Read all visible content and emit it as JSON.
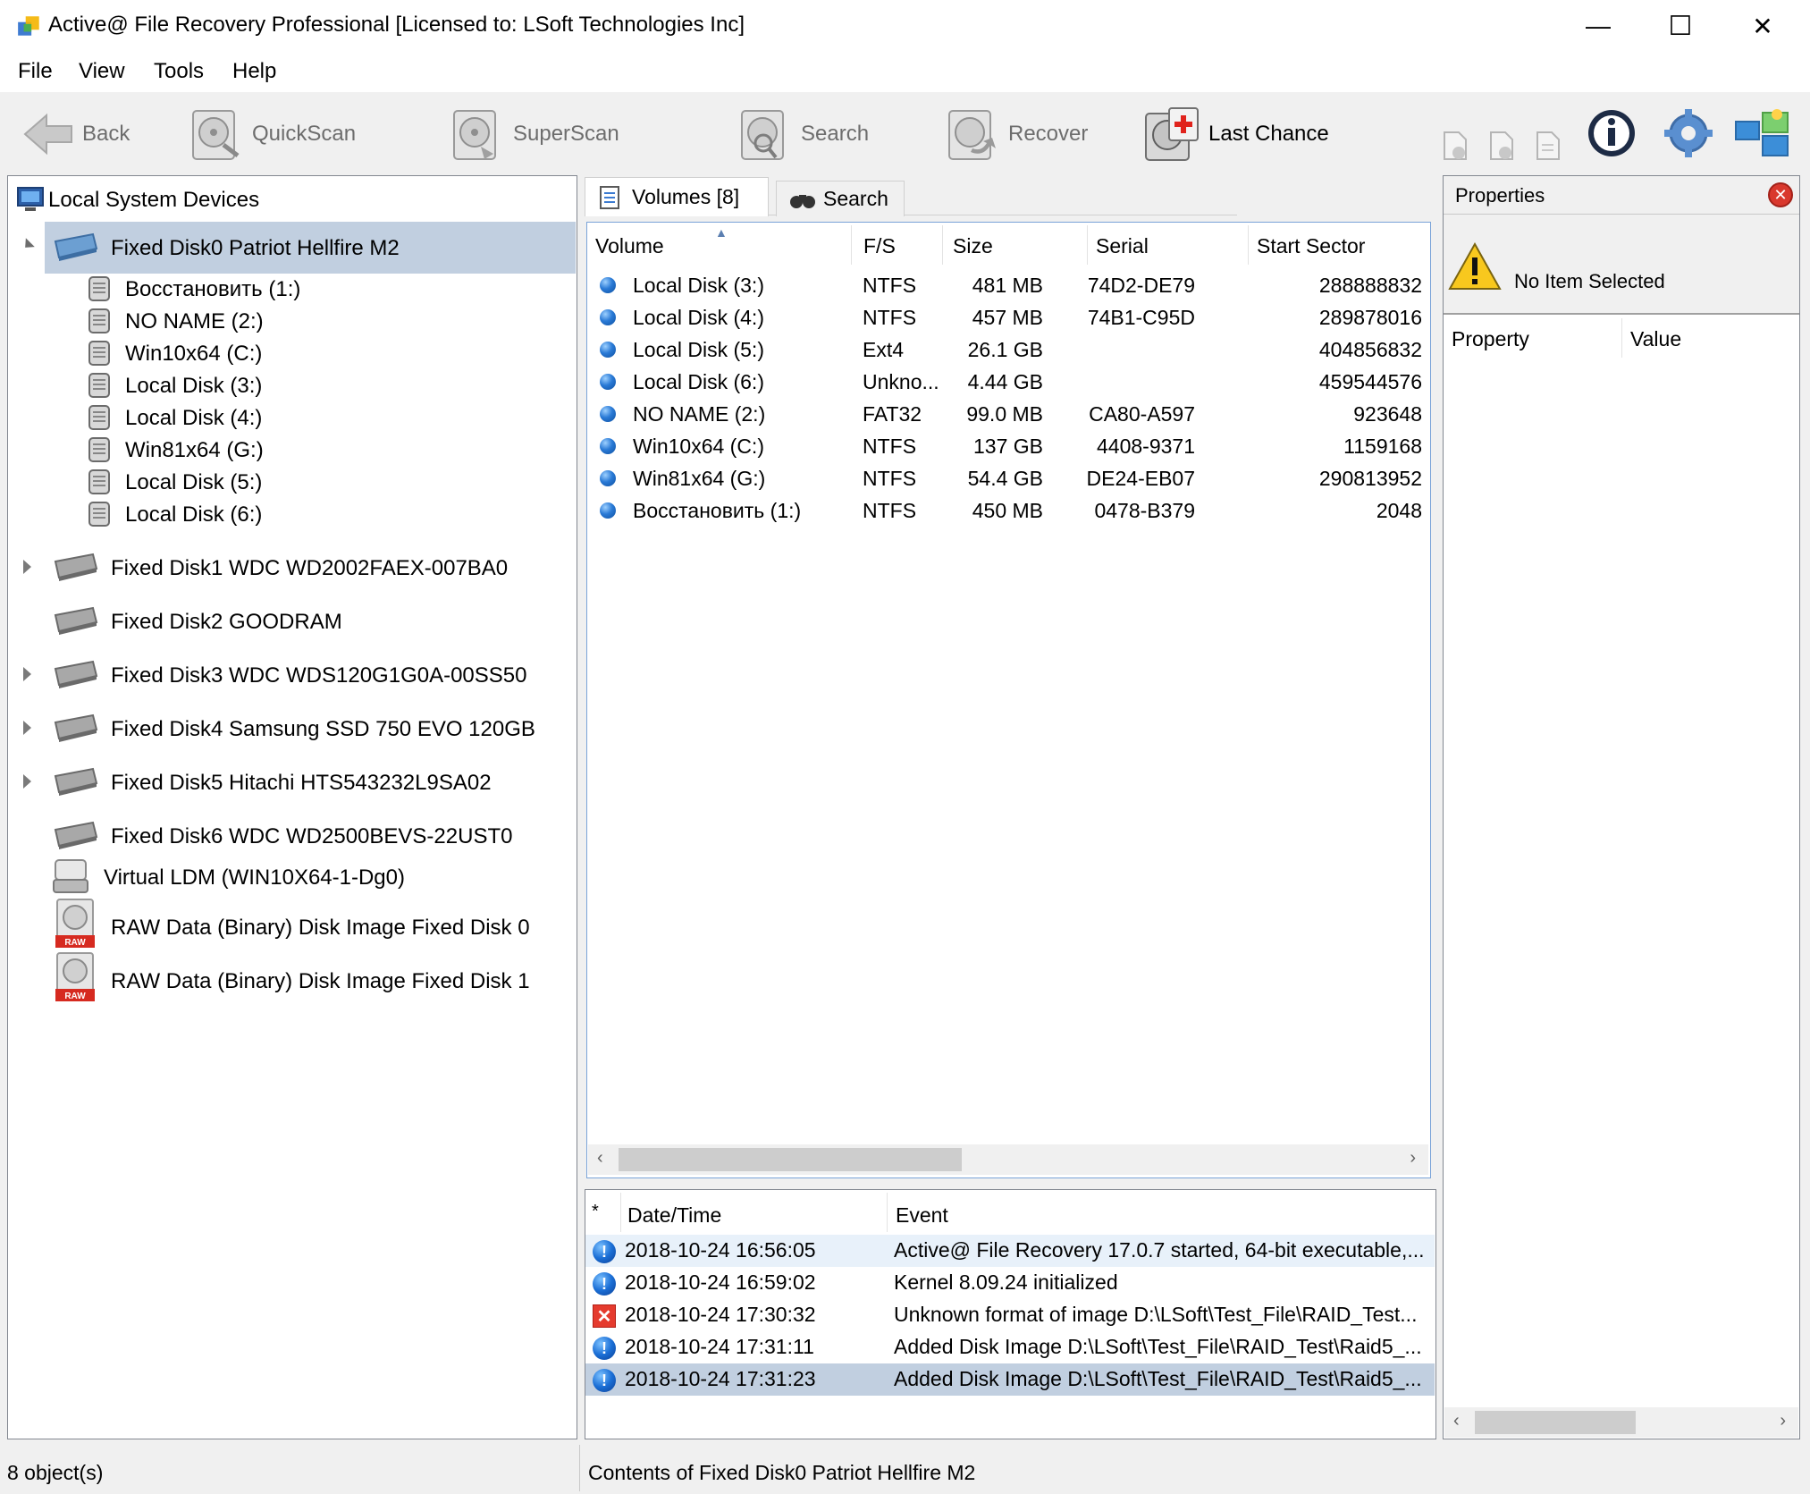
{
  "window": {
    "title": "Active@ File Recovery Professional [Licensed to: LSoft Technologies Inc]",
    "minimize_glyph": "—",
    "maximize_glyph": "☐",
    "close_glyph": "✕"
  },
  "menu": {
    "items": [
      "File",
      "View",
      "Tools",
      "Help"
    ]
  },
  "toolbar": {
    "back": "Back",
    "quickscan": "QuickScan",
    "superscan": "SuperScan",
    "search": "Search",
    "recover": "Recover",
    "last_chance": "Last Chance"
  },
  "tree": {
    "root": "Local System Devices",
    "disk0": {
      "label": "Fixed Disk0 Patriot Hellfire M2",
      "volumes": [
        "Восстановить (1:)",
        "NO NAME (2:)",
        "Win10x64 (C:)",
        "Local Disk (3:)",
        "Local Disk (4:)",
        "Win81x64 (G:)",
        "Local Disk (5:)",
        "Local Disk (6:)"
      ]
    },
    "disks": [
      {
        "label": "Fixed Disk1 WDC WD2002FAEX-007BA0",
        "expandable": true
      },
      {
        "label": "Fixed Disk2 GOODRAM",
        "expandable": false
      },
      {
        "label": "Fixed Disk3 WDC WDS120G1G0A-00SS50",
        "expandable": true
      },
      {
        "label": "Fixed Disk4 Samsung SSD 750 EVO 120GB",
        "expandable": true
      },
      {
        "label": "Fixed Disk5 Hitachi HTS543232L9SA02",
        "expandable": true
      },
      {
        "label": "Fixed Disk6 WDC WD2500BEVS-22UST0",
        "expandable": false
      }
    ],
    "virtual": "Virtual LDM (WIN10X64-1-Dg0)",
    "raw_images": [
      "RAW Data (Binary) Disk Image Fixed Disk 0",
      "RAW Data (Binary) Disk Image Fixed Disk 1"
    ],
    "raw_badge": "RAW"
  },
  "tabs": {
    "volumes": "Volumes [8]",
    "search": "Search"
  },
  "volumes_table": {
    "headers": [
      "Volume",
      "F/S",
      "Size",
      "Serial",
      "Start Sector"
    ],
    "sort_glyph": "▲",
    "rows": [
      {
        "volume": "Local Disk (3:)",
        "fs": "NTFS",
        "size": "481 MB",
        "serial": "74D2-DE79",
        "start": "288888832"
      },
      {
        "volume": "Local Disk (4:)",
        "fs": "NTFS",
        "size": "457 MB",
        "serial": "74B1-C95D",
        "start": "289878016"
      },
      {
        "volume": "Local Disk (5:)",
        "fs": "Ext4",
        "size": "26.1 GB",
        "serial": "",
        "start": "404856832"
      },
      {
        "volume": "Local Disk (6:)",
        "fs": "Unkno...",
        "size": "4.44 GB",
        "serial": "",
        "start": "459544576"
      },
      {
        "volume": "NO NAME (2:)",
        "fs": "FAT32",
        "size": "99.0 MB",
        "serial": "CA80-A597",
        "start": "923648"
      },
      {
        "volume": "Win10x64 (C:)",
        "fs": "NTFS",
        "size": "137 GB",
        "serial": "4408-9371",
        "start": "1159168"
      },
      {
        "volume": "Win81x64 (G:)",
        "fs": "NTFS",
        "size": "54.4 GB",
        "serial": "DE24-EB07",
        "start": "290813952"
      },
      {
        "volume": "Восстановить (1:)",
        "fs": "NTFS",
        "size": "450 MB",
        "serial": "0478-B379",
        "start": "2048"
      }
    ]
  },
  "log_table": {
    "headers": [
      "*",
      "Date/Time",
      "Event"
    ],
    "rows": [
      {
        "type": "info",
        "datetime": "2018-10-24 16:56:05",
        "event": "Active@ File Recovery 17.0.7 started, 64-bit executable,..."
      },
      {
        "type": "info",
        "datetime": "2018-10-24 16:59:02",
        "event": "Kernel 8.09.24 initialized"
      },
      {
        "type": "error",
        "datetime": "2018-10-24 17:30:32",
        "event": "Unknown format of image D:\\LSoft\\Test_File\\RAID_Test..."
      },
      {
        "type": "info",
        "datetime": "2018-10-24 17:31:11",
        "event": "Added Disk Image D:\\LSoft\\Test_File\\RAID_Test\\Raid5_..."
      },
      {
        "type": "info",
        "datetime": "2018-10-24 17:31:23",
        "event": "Added Disk Image D:\\LSoft\\Test_File\\RAID_Test\\Raid5_..."
      }
    ],
    "info_glyph": "!",
    "error_glyph": "✕"
  },
  "properties": {
    "title": "Properties",
    "no_item": "No Item Selected",
    "col_property": "Property",
    "col_value": "Value",
    "warn_glyph": "!",
    "close_glyph": "✕"
  },
  "status": {
    "left": "8 object(s)",
    "right": "Contents of Fixed Disk0 Patriot Hellfire M2"
  },
  "scroll": {
    "left_glyph": "‹",
    "right_glyph": "›"
  },
  "colors": {
    "selection": "#c1cfe0",
    "window_bg": "#f0f0f0",
    "panel_border": "#828790",
    "accent_blue": "#2a7ad6",
    "error_red": "#e53b2e"
  }
}
